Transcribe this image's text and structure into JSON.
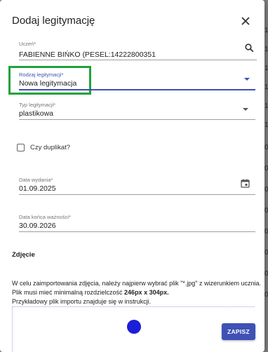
{
  "background": {
    "row_markers": [
      "1",
      "1",
      "1",
      "1",
      "1",
      "1",
      "0",
      "0",
      "0",
      "0",
      "0",
      "0",
      "0",
      "0"
    ]
  },
  "dialog": {
    "title": "Dodaj legitymację",
    "close_icon": "close-icon",
    "student": {
      "label": "Uczeń*",
      "value": "FABIENNE BIŃKO (PESEL:14222800351",
      "icon": "search-icon"
    },
    "id_type": {
      "label": "Rodzaj legitymacji*",
      "value": "Nowa legitymacja",
      "icon": "chevron-down-icon"
    },
    "card_type": {
      "label": "Typ legitymacji*",
      "value": "plastikowa",
      "icon": "chevron-down-icon"
    },
    "duplicate": {
      "label": "Czy duplikat?",
      "checked": false
    },
    "issue_date": {
      "label": "Data wydania*",
      "value": "01.09.2025",
      "icon": "calendar-icon"
    },
    "expiry_date": {
      "label": "Data końca ważności*",
      "value": "30.09.2026"
    },
    "photo": {
      "title": "Zdjęcie",
      "line1": "W celu zaimportowania zdjęcia, należy najpierw wybrać plik \"*.jpg\" z wizerunkiem ucznia.",
      "line2_prefix": "Plik musi mieć minimalną rozdzielczość ",
      "line2_bold": "246px x 304px.",
      "line3": "Przykładowy plik importu znajduje się w instrukcji."
    },
    "save_label": "ZAPISZ"
  },
  "colors": {
    "accent": "#3f51b5",
    "highlight": "#1fa33a",
    "upload": "#1d1fd8"
  }
}
